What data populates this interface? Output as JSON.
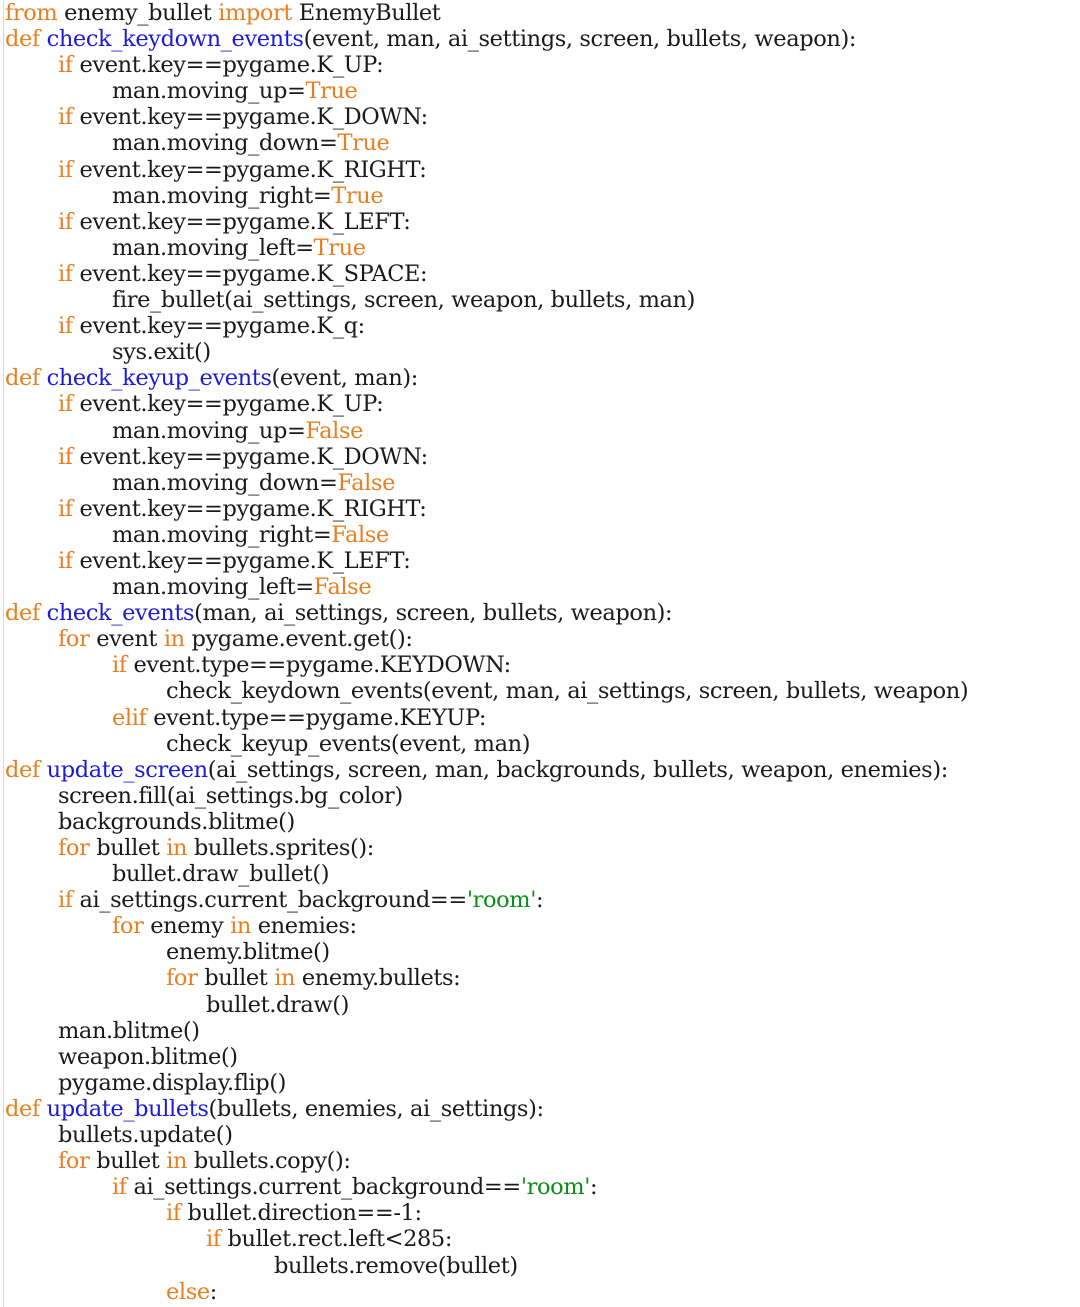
{
  "editor": {
    "lines": [
      {
        "indent": 0,
        "tokens": [
          [
            "kw",
            "from"
          ],
          [
            "txt",
            " enemy_bullet "
          ],
          [
            "kw",
            "import"
          ],
          [
            "txt",
            " EnemyBullet"
          ]
        ]
      },
      {
        "indent": 0,
        "tokens": [
          [
            "kw",
            "def"
          ],
          [
            "txt",
            " "
          ],
          [
            "fn",
            "check_keydown_events"
          ],
          [
            "txt",
            "(event, man, ai_settings, screen, bullets, weapon):"
          ]
        ]
      },
      {
        "indent": 1,
        "tokens": [
          [
            "kw",
            "if"
          ],
          [
            "txt",
            " event.key==pygame.K_UP:"
          ]
        ]
      },
      {
        "indent": 2,
        "tokens": [
          [
            "txt",
            "man.moving_up="
          ],
          [
            "kw",
            "True"
          ]
        ]
      },
      {
        "indent": 1,
        "tokens": [
          [
            "kw",
            "if"
          ],
          [
            "txt",
            " event.key==pygame.K_DOWN:"
          ]
        ]
      },
      {
        "indent": 2,
        "tokens": [
          [
            "txt",
            "man.moving_down="
          ],
          [
            "kw",
            "True"
          ]
        ]
      },
      {
        "indent": 1,
        "tokens": [
          [
            "kw",
            "if"
          ],
          [
            "txt",
            " event.key==pygame.K_RIGHT:"
          ]
        ]
      },
      {
        "indent": 2,
        "tokens": [
          [
            "txt",
            "man.moving_right="
          ],
          [
            "kw",
            "True"
          ]
        ]
      },
      {
        "indent": 1,
        "tokens": [
          [
            "kw",
            "if"
          ],
          [
            "txt",
            " event.key==pygame.K_LEFT:"
          ]
        ]
      },
      {
        "indent": 2,
        "tokens": [
          [
            "txt",
            "man.moving_left="
          ],
          [
            "kw",
            "True"
          ]
        ]
      },
      {
        "indent": 1,
        "tokens": [
          [
            "kw",
            "if"
          ],
          [
            "txt",
            " event.key==pygame.K_SPACE:"
          ]
        ]
      },
      {
        "indent": 2,
        "tokens": [
          [
            "txt",
            "fire_bullet(ai_settings, screen, weapon, bullets, man)"
          ]
        ]
      },
      {
        "indent": 1,
        "tokens": [
          [
            "kw",
            "if"
          ],
          [
            "txt",
            " event.key==pygame.K_q:"
          ]
        ]
      },
      {
        "indent": 2,
        "tokens": [
          [
            "txt",
            "sys.exit()"
          ]
        ]
      },
      {
        "indent": 0,
        "tokens": [
          [
            "kw",
            "def"
          ],
          [
            "txt",
            " "
          ],
          [
            "fn",
            "check_keyup_events"
          ],
          [
            "txt",
            "(event, man):"
          ]
        ]
      },
      {
        "indent": 1,
        "tokens": [
          [
            "kw",
            "if"
          ],
          [
            "txt",
            " event.key==pygame.K_UP:"
          ]
        ]
      },
      {
        "indent": 2,
        "tokens": [
          [
            "txt",
            "man.moving_up="
          ],
          [
            "kw",
            "False"
          ]
        ]
      },
      {
        "indent": 1,
        "tokens": [
          [
            "kw",
            "if"
          ],
          [
            "txt",
            " event.key==pygame.K_DOWN:"
          ]
        ]
      },
      {
        "indent": 2,
        "tokens": [
          [
            "txt",
            "man.moving_down="
          ],
          [
            "kw",
            "False"
          ]
        ]
      },
      {
        "indent": 1,
        "tokens": [
          [
            "kw",
            "if"
          ],
          [
            "txt",
            " event.key==pygame.K_RIGHT:"
          ]
        ]
      },
      {
        "indent": 2,
        "tokens": [
          [
            "txt",
            "man.moving_right="
          ],
          [
            "kw",
            "False"
          ]
        ]
      },
      {
        "indent": 1,
        "tokens": [
          [
            "kw",
            "if"
          ],
          [
            "txt",
            " event.key==pygame.K_LEFT:"
          ]
        ]
      },
      {
        "indent": 2,
        "tokens": [
          [
            "txt",
            "man.moving_left="
          ],
          [
            "kw",
            "False"
          ]
        ]
      },
      {
        "indent": 0,
        "tokens": [
          [
            "kw",
            "def"
          ],
          [
            "txt",
            " "
          ],
          [
            "fn",
            "check_events"
          ],
          [
            "txt",
            "(man, ai_settings, screen, bullets, weapon):"
          ]
        ]
      },
      {
        "indent": 1,
        "tokens": [
          [
            "kw",
            "for"
          ],
          [
            "txt",
            " event "
          ],
          [
            "kw",
            "in"
          ],
          [
            "txt",
            " pygame.event.get():"
          ]
        ]
      },
      {
        "indent": 2,
        "tokens": [
          [
            "kw",
            "if"
          ],
          [
            "txt",
            " event.type==pygame.KEYDOWN:"
          ]
        ]
      },
      {
        "indent": 3,
        "tokens": [
          [
            "txt",
            "check_keydown_events(event, man, ai_settings, screen, bullets, weapon)"
          ]
        ]
      },
      {
        "indent": 2,
        "tokens": [
          [
            "kw",
            "elif"
          ],
          [
            "txt",
            " event.type==pygame.KEYUP:"
          ]
        ]
      },
      {
        "indent": 3,
        "tokens": [
          [
            "txt",
            "check_keyup_events(event, man)"
          ]
        ]
      },
      {
        "indent": 0,
        "tokens": [
          [
            "kw",
            "def"
          ],
          [
            "txt",
            " "
          ],
          [
            "fn",
            "update_screen"
          ],
          [
            "txt",
            "(ai_settings, screen, man, backgrounds, bullets, weapon, enemies):"
          ]
        ]
      },
      {
        "indent": 1,
        "tokens": [
          [
            "txt",
            "screen.fill(ai_settings.bg_color)"
          ]
        ]
      },
      {
        "indent": 1,
        "tokens": [
          [
            "txt",
            "backgrounds.blitme()"
          ]
        ]
      },
      {
        "indent": 1,
        "tokens": [
          [
            "kw",
            "for"
          ],
          [
            "txt",
            " bullet "
          ],
          [
            "kw",
            "in"
          ],
          [
            "txt",
            " bullets.sprites():"
          ]
        ]
      },
      {
        "indent": 2,
        "tokens": [
          [
            "txt",
            "bullet.draw_bullet()"
          ]
        ]
      },
      {
        "indent": 1,
        "tokens": [
          [
            "kw",
            "if"
          ],
          [
            "txt",
            " ai_settings.current_background=="
          ],
          [
            "str",
            "'room'"
          ],
          [
            "txt",
            ":"
          ]
        ]
      },
      {
        "indent": 2,
        "tokens": [
          [
            "kw",
            "for"
          ],
          [
            "txt",
            " enemy "
          ],
          [
            "kw",
            "in"
          ],
          [
            "txt",
            " enemies:"
          ]
        ]
      },
      {
        "indent": 3,
        "tokens": [
          [
            "txt",
            "enemy.blitme()"
          ]
        ]
      },
      {
        "indent": 3,
        "tokens": [
          [
            "kw",
            "for"
          ],
          [
            "txt",
            " bullet "
          ],
          [
            "kw",
            "in"
          ],
          [
            "txt",
            " enemy.bullets:"
          ]
        ]
      },
      {
        "indent": 4,
        "tokens": [
          [
            "txt",
            "bullet.draw()"
          ]
        ]
      },
      {
        "indent": 1,
        "tokens": [
          [
            "txt",
            "man.blitme()"
          ]
        ]
      },
      {
        "indent": 1,
        "tokens": [
          [
            "txt",
            "weapon.blitme()"
          ]
        ]
      },
      {
        "indent": 1,
        "tokens": [
          [
            "txt",
            "pygame.display.flip()"
          ]
        ]
      },
      {
        "indent": 0,
        "tokens": [
          [
            "kw",
            "def"
          ],
          [
            "txt",
            " "
          ],
          [
            "fn",
            "update_bullets"
          ],
          [
            "txt",
            "(bullets, enemies, ai_settings):"
          ]
        ]
      },
      {
        "indent": 1,
        "tokens": [
          [
            "txt",
            "bullets.update()"
          ]
        ]
      },
      {
        "indent": 1,
        "tokens": [
          [
            "kw",
            "for"
          ],
          [
            "txt",
            " bullet "
          ],
          [
            "kw",
            "in"
          ],
          [
            "txt",
            " bullets.copy():"
          ]
        ]
      },
      {
        "indent": 2,
        "tokens": [
          [
            "kw",
            "if"
          ],
          [
            "txt",
            " ai_settings.current_background=="
          ],
          [
            "str",
            "'room'"
          ],
          [
            "txt",
            ":"
          ]
        ]
      },
      {
        "indent": 3,
        "tokens": [
          [
            "kw",
            "if"
          ],
          [
            "txt",
            " bullet.direction==-1:"
          ]
        ]
      },
      {
        "indent": 4,
        "tokens": [
          [
            "kw",
            "if"
          ],
          [
            "txt",
            " bullet.rect.left<285:"
          ]
        ]
      },
      {
        "indent": 5,
        "tokens": [
          [
            "txt",
            "bullets.remove(bullet)"
          ]
        ]
      },
      {
        "indent": 3,
        "tokens": [
          [
            "kw",
            "else"
          ],
          [
            "txt",
            ":"
          ]
        ]
      }
    ]
  }
}
